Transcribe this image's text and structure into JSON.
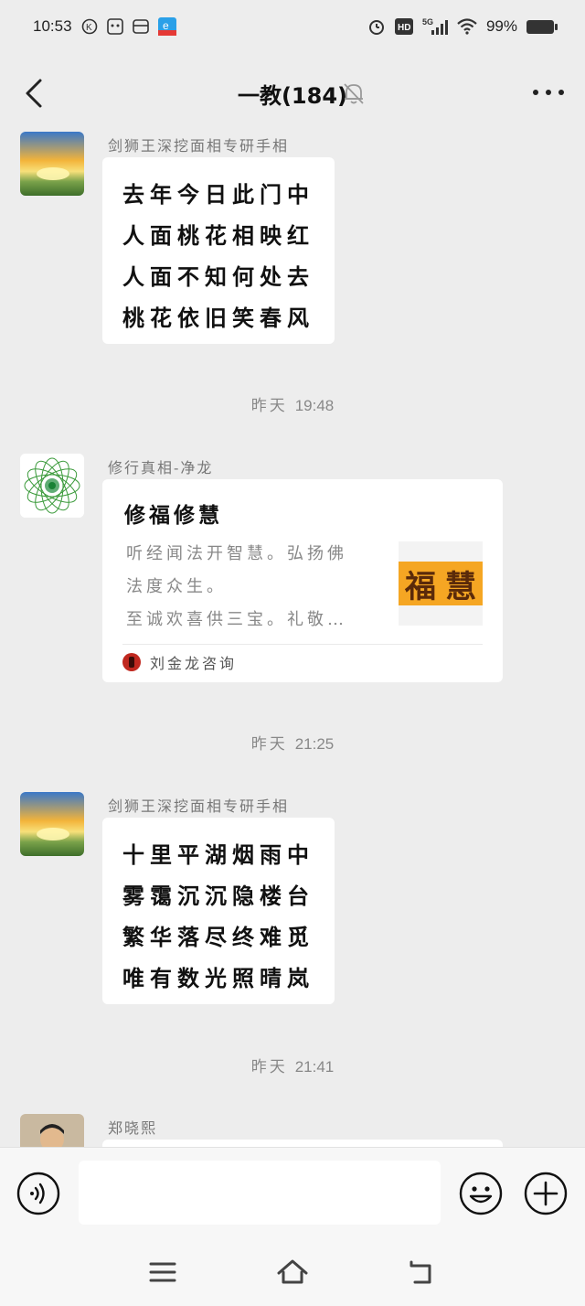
{
  "status_bar": {
    "time": "10:53",
    "network": "5G",
    "hd": "HD",
    "battery": "99%"
  },
  "header": {
    "title": "一教(184)"
  },
  "messages": [
    {
      "sender": "剑狮王深挖面相专研手相",
      "lines": [
        "去年今日此门中",
        "人面桃花相映红",
        "人面不知何处去",
        "桃花依旧笑春风"
      ]
    },
    {
      "sender": "修行真相-净龙",
      "card": {
        "title": "修福修慧",
        "desc": [
          "听经闻法开智慧。弘扬佛",
          "法度众生。",
          "至诚欢喜供三宝。礼敬…"
        ],
        "thumb": [
          "福",
          "慧"
        ],
        "source": "刘金龙咨询"
      }
    },
    {
      "sender": "剑狮王深挖面相专研手相",
      "lines": [
        "十里平湖烟雨中",
        "雾霭沉沉隐楼台",
        "繁华落尽终难觅",
        "唯有数光照晴岚"
      ]
    },
    {
      "sender": "郑晓熙"
    }
  ],
  "time_separators": [
    {
      "day": "昨天",
      "time": "19:48"
    },
    {
      "day": "昨天",
      "time": "21:25"
    },
    {
      "day": "昨天",
      "time": "21:41"
    }
  ],
  "input": {
    "placeholder": "",
    "value": ""
  },
  "colors": {
    "background": "#ededed",
    "bubble": "#ffffff",
    "thumb_orange": "#f5a623"
  }
}
